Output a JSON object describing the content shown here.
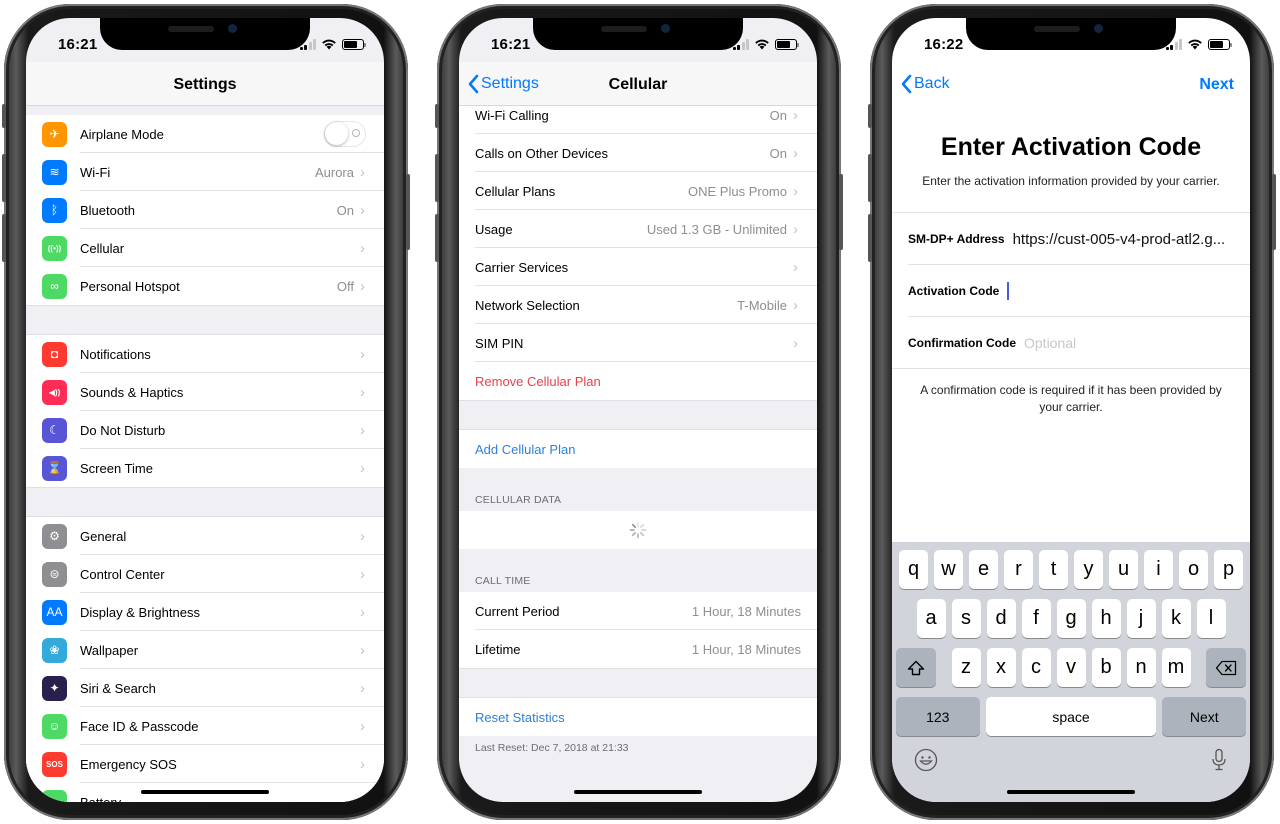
{
  "status_bars": [
    {
      "time": "16:21"
    },
    {
      "time": "16:21"
    },
    {
      "time": "16:22"
    }
  ],
  "settings_screen": {
    "title": "Settings",
    "groups": [
      [
        {
          "label": "Airplane Mode",
          "icon": "airplane-icon",
          "icon_color": "#ff9500",
          "toggle": false
        },
        {
          "label": "Wi-Fi",
          "icon": "wifi-icon",
          "icon_color": "#007aff",
          "value": "Aurora"
        },
        {
          "label": "Bluetooth",
          "icon": "bluetooth-icon",
          "icon_color": "#007aff",
          "value": "On"
        },
        {
          "label": "Cellular",
          "icon": "antenna-icon",
          "icon_color": "#4cd964",
          "value": ""
        },
        {
          "label": "Personal Hotspot",
          "icon": "hotspot-icon",
          "icon_color": "#4cd964",
          "value": "Off"
        }
      ],
      [
        {
          "label": "Notifications",
          "icon": "notifications-icon",
          "icon_color": "#ff3b30",
          "value": ""
        },
        {
          "label": "Sounds & Haptics",
          "icon": "speaker-icon",
          "icon_color": "#ff2d55",
          "value": ""
        },
        {
          "label": "Do Not Disturb",
          "icon": "moon-icon",
          "icon_color": "#5856d6",
          "value": ""
        },
        {
          "label": "Screen Time",
          "icon": "hourglass-icon",
          "icon_color": "#5856d6",
          "value": ""
        }
      ],
      [
        {
          "label": "General",
          "icon": "gear-icon",
          "icon_color": "#8e8e93",
          "value": ""
        },
        {
          "label": "Control Center",
          "icon": "switches-icon",
          "icon_color": "#8e8e93",
          "value": ""
        },
        {
          "label": "Display & Brightness",
          "icon": "text-size-icon",
          "icon_color": "#007aff",
          "value": ""
        },
        {
          "label": "Wallpaper",
          "icon": "flower-icon",
          "icon_color": "#34aadc",
          "value": ""
        },
        {
          "label": "Siri & Search",
          "icon": "siri-icon",
          "icon_color": "#2a1f4d",
          "value": ""
        },
        {
          "label": "Face ID & Passcode",
          "icon": "face-id-icon",
          "icon_color": "#4cd964",
          "value": ""
        },
        {
          "label": "Emergency SOS",
          "icon": "sos-icon",
          "icon_color": "#ff3b30",
          "value": ""
        },
        {
          "label": "Battery",
          "icon": "battery-icon",
          "icon_color": "#4cd964",
          "value": ""
        }
      ]
    ],
    "icon_glyphs": {
      "airplane-icon": "✈",
      "wifi-icon": "≋",
      "bluetooth-icon": "ᛒ",
      "antenna-icon": "((•))",
      "hotspot-icon": "∞",
      "notifications-icon": "◘",
      "speaker-icon": "◀))",
      "moon-icon": "☾",
      "hourglass-icon": "⌛",
      "gear-icon": "⚙",
      "switches-icon": "⊜",
      "text-size-icon": "AA",
      "flower-icon": "❀",
      "siri-icon": "✦",
      "face-id-icon": "☺",
      "sos-icon": "SOS",
      "battery-icon": "▬"
    }
  },
  "cellular_screen": {
    "back_label": "Settings",
    "title": "Cellular",
    "rows_top": [
      {
        "label": "Wi-Fi Calling",
        "value": "On",
        "chevron": true
      },
      {
        "label": "Calls on Other Devices",
        "value": "On",
        "chevron": true
      },
      {
        "label": "Cellular Plans",
        "value": "ONE Plus Promo",
        "chevron": true
      },
      {
        "label": "Usage",
        "value": "Used 1.3 GB - Unlimited",
        "chevron": true
      },
      {
        "label": "Carrier Services",
        "value": "",
        "chevron": true
      },
      {
        "label": "Network Selection",
        "value": "T-Mobile",
        "chevron": true
      },
      {
        "label": "SIM PIN",
        "value": "",
        "chevron": true
      }
    ],
    "remove_plan": "Remove Cellular Plan",
    "add_plan": "Add Cellular Plan",
    "cellular_data_header": "CELLULAR DATA",
    "call_time_header": "CALL TIME",
    "call_time_rows": [
      {
        "label": "Current Period",
        "value": "1 Hour, 18 Minutes"
      },
      {
        "label": "Lifetime",
        "value": "1 Hour, 18 Minutes"
      }
    ],
    "reset_statistics": "Reset Statistics",
    "last_reset": "Last Reset: Dec 7, 2018 at 21:33"
  },
  "activation_screen": {
    "back_label": "Back",
    "next_label": "Next",
    "headline": "Enter Activation Code",
    "subtitle": "Enter the activation information provided by your carrier.",
    "fields": [
      {
        "label": "SM-DP+ Address",
        "value": "https://cust-005-v4-prod-atl2.g...",
        "placeholder": ""
      },
      {
        "label": "Activation Code",
        "value": "",
        "placeholder": ""
      },
      {
        "label": "Confirmation Code",
        "value": "",
        "placeholder": "Optional"
      }
    ],
    "note": "A confirmation code is required if it has been provided by your carrier.",
    "keyboard": {
      "row1": [
        "q",
        "w",
        "e",
        "r",
        "t",
        "y",
        "u",
        "i",
        "o",
        "p"
      ],
      "row2": [
        "a",
        "s",
        "d",
        "f",
        "g",
        "h",
        "j",
        "k",
        "l"
      ],
      "row3": [
        "z",
        "x",
        "c",
        "v",
        "b",
        "n",
        "m"
      ],
      "numbers_key": "123",
      "space_key": "space",
      "return_key": "Next"
    }
  },
  "colors": {
    "ios_blue": "#007aff",
    "link_blue": "#2f80d6",
    "destructive_red": "#e8414d",
    "grouped_background": "#efeff4",
    "secondary_text": "#8e8e93"
  }
}
